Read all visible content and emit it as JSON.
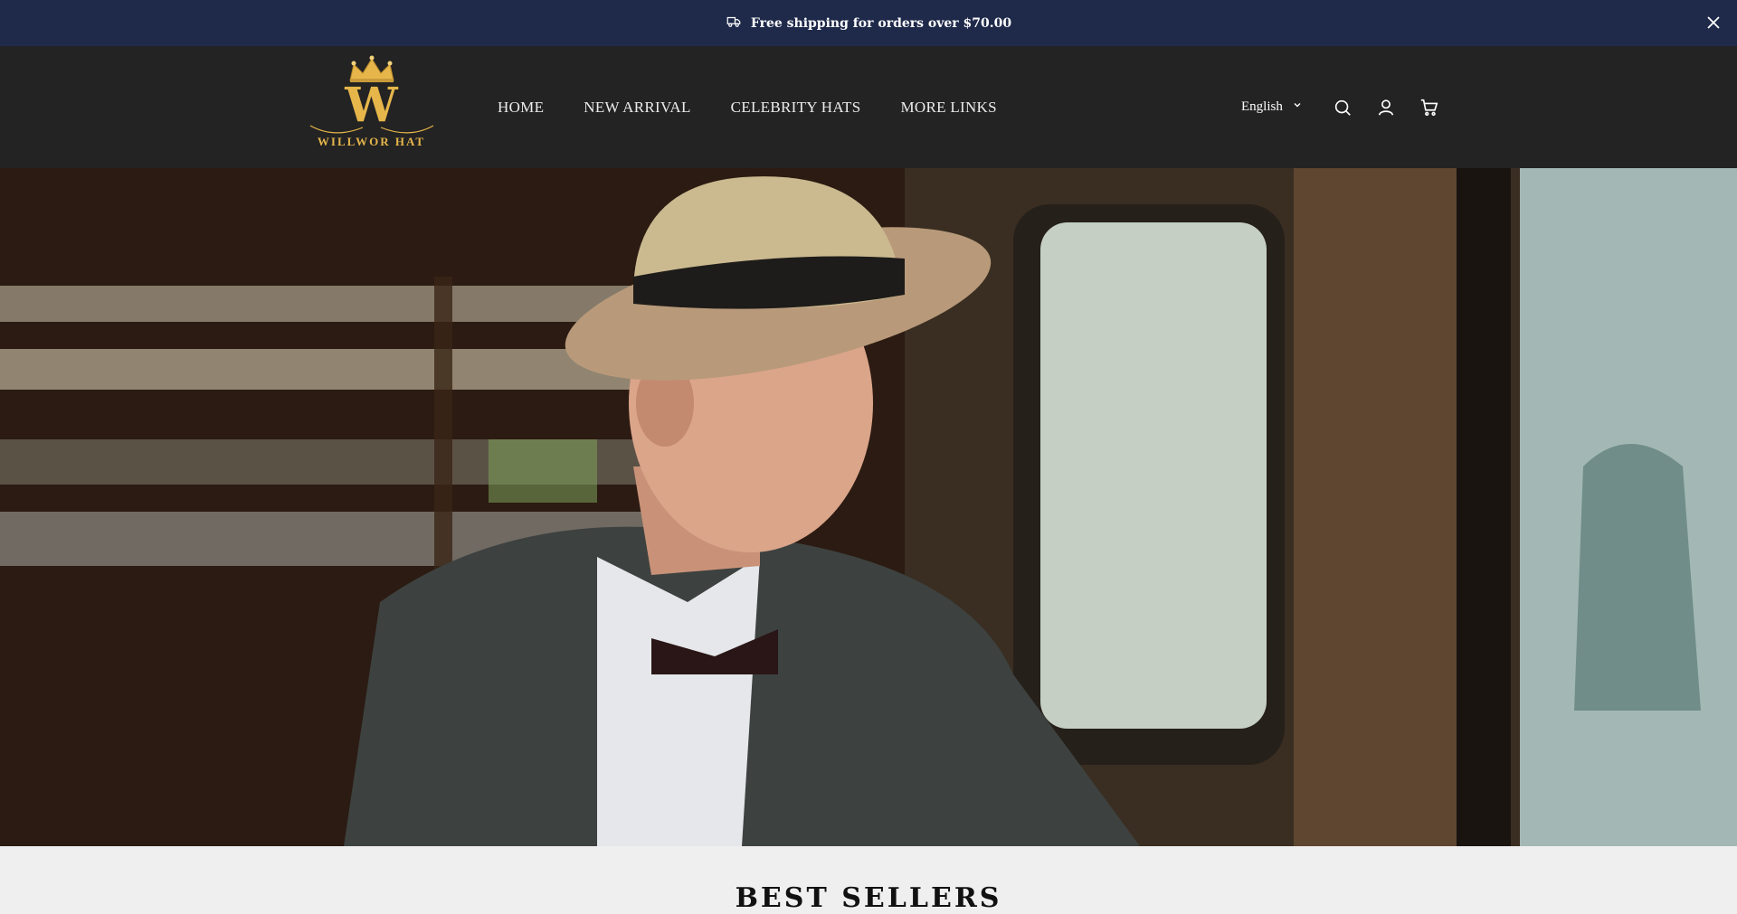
{
  "announcement": {
    "text": "Free shipping for orders over $70.00",
    "icon": "truck-icon",
    "close_icon": "close-icon"
  },
  "header": {
    "logo": {
      "text": "WILLWOR HAT",
      "letter": "W"
    },
    "nav": [
      {
        "label": "HOME"
      },
      {
        "label": "NEW ARRIVAL"
      },
      {
        "label": "CELEBRITY HATS"
      },
      {
        "label": "MORE LINKS"
      }
    ],
    "language": {
      "selected": "English"
    },
    "icons": [
      "search-icon",
      "account-icon",
      "cart-icon"
    ]
  },
  "hero": {
    "image": "man-in-fedora-on-train"
  },
  "sections": {
    "best_sellers_title": "BEST SELLERS"
  },
  "colors": {
    "announcement_bg": "#1f2a4a",
    "header_bg": "#232323",
    "logo_gold": "#e6b64a",
    "page_bg": "#efefef"
  }
}
